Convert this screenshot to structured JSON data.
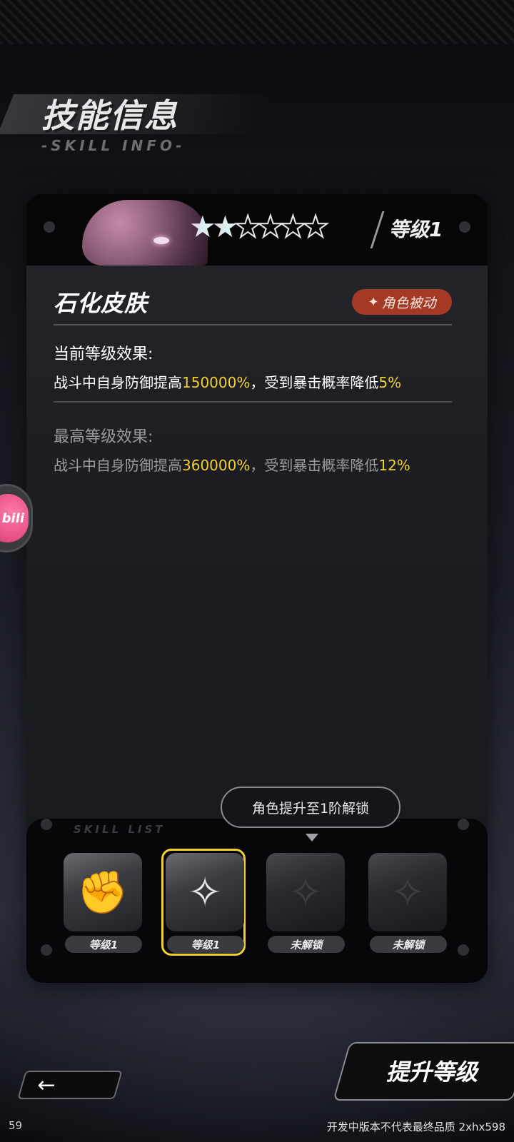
{
  "header": {
    "title": "技能信息",
    "subtitle": "-SKILL INFO-"
  },
  "skill_card": {
    "stars_total": 6,
    "stars_filled": 2,
    "level_label": "等级1",
    "skill_name": "石化皮肤",
    "type_badge": "角色被动",
    "current_effect": {
      "title": "当前等级效果:",
      "text_1": "战斗中自身防御提高",
      "value_1": "150000%",
      "text_2": "，受到暴击概率降低",
      "value_2": "5%"
    },
    "max_effect": {
      "title": "最高等级效果:",
      "text_1": "战斗中自身防御提高",
      "value_1": "360000%",
      "text_2": "，受到暴击概率降低",
      "value_2": "12%"
    }
  },
  "tooltip": "角色提升至1阶解锁",
  "skill_list": {
    "label": "SKILL LIST",
    "slots": [
      {
        "label": "等级1",
        "icon": "fist-icon",
        "locked": false,
        "selected": false
      },
      {
        "label": "等级1",
        "icon": "shield-star-icon",
        "locked": false,
        "selected": true
      },
      {
        "label": "未解锁",
        "icon": "shield-star-icon",
        "locked": true,
        "selected": false
      },
      {
        "label": "未解锁",
        "icon": "shield-star-icon",
        "locked": true,
        "selected": false
      }
    ]
  },
  "buttons": {
    "back_icon": "←",
    "upgrade": "提升等级"
  },
  "floating_badge": "bili",
  "footer": {
    "fps": "59",
    "note": "开发中版本不代表最终品质 2xhx598"
  },
  "colors": {
    "highlight": "#f2cf2c",
    "badge_bg": "#a53a24",
    "selected_border": "#f2cf2c"
  }
}
